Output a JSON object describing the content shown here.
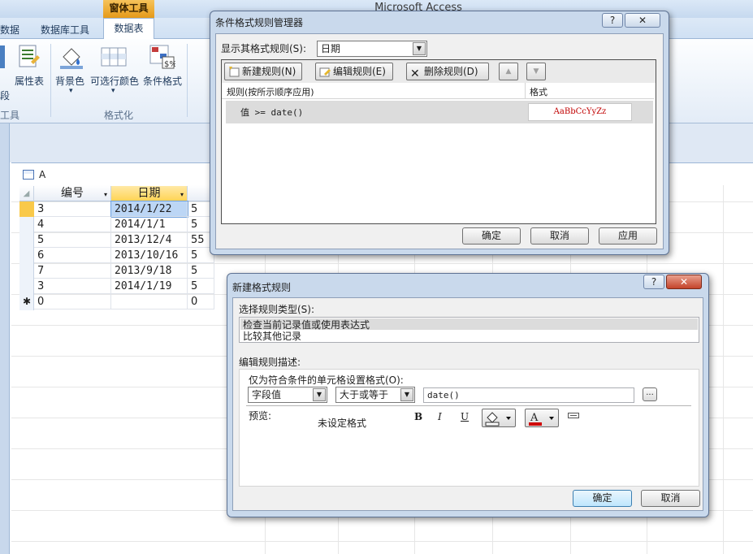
{
  "app": {
    "title": "Microsoft Access",
    "context_group": "窗体工具",
    "tabs": {
      "partial_data": "数据",
      "db_tools": "数据库工具",
      "datasheet": "数据表"
    },
    "ribbon": {
      "properties_label": "属性表",
      "field_partial": "段",
      "tools_partial": "工具",
      "bg_color_label": "背景色",
      "alt_row_color_label": "可选行颜色",
      "cond_format_label": "条件格式",
      "group_format_label": "格式化"
    }
  },
  "datasheet": {
    "tab_label": "A",
    "columns": [
      "编号",
      "日期",
      ""
    ],
    "rows": [
      [
        "3",
        "2014/1/22",
        "5"
      ],
      [
        "4",
        "2014/1/1",
        "5"
      ],
      [
        "5",
        "2013/12/4",
        "55"
      ],
      [
        "6",
        "2013/10/16",
        "5"
      ],
      [
        "7",
        "2013/9/18",
        "5"
      ],
      [
        "3",
        "2014/1/19",
        "5"
      ]
    ],
    "new_row": [
      "0",
      "",
      "0"
    ],
    "new_row_marker": "✱"
  },
  "manager": {
    "title": "条件格式规则管理器",
    "show_rules_label": "显示其格式规则(S):",
    "show_rules_value": "日期",
    "new_rule": "新建规则(N)",
    "edit_rule": "编辑规则(E)",
    "delete_rule": "删除规则(D)",
    "col_rule": "规则(按所示顺序应用)",
    "col_format": "格式",
    "rule_text": "值 >= date()",
    "format_sample": "AaBbCcYyZz",
    "ok": "确定",
    "cancel": "取消",
    "apply": "应用",
    "help": "?",
    "close": "✕"
  },
  "new_rule": {
    "title": "新建格式规则",
    "select_type_label": "选择规则类型(S):",
    "types": [
      "检查当前记录值或使用表达式",
      "比较其他记录"
    ],
    "edit_desc_label": "编辑规则描述:",
    "only_format_label": "仅为符合条件的单元格设置格式(O):",
    "field_select": "字段值",
    "operator_select": "大于或等于",
    "expr_value": "date()",
    "more": "...",
    "preview_label": "预览:",
    "preview_text": "未设定格式",
    "bold": "B",
    "italic": "I",
    "underline": "U",
    "ok": "确定",
    "cancel": "取消",
    "help": "?",
    "close": "✕"
  },
  "colors": {
    "selection": "#bcd6f5",
    "active_header": "#ffd352",
    "sample_red": "#c00000",
    "context_orange": "#e59a1a"
  }
}
